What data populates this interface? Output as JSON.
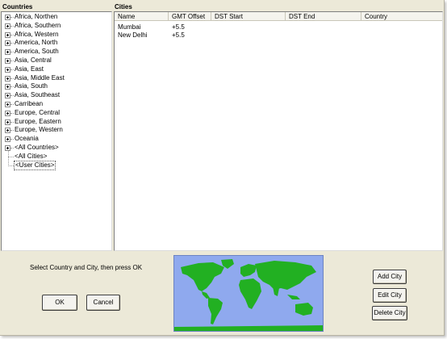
{
  "countries_pane": {
    "title": "Countries",
    "regions": [
      "Africa, Northen",
      "Africa, Southern",
      "Africa, Western",
      "America, North",
      "America, South",
      "Asia, Central",
      "Asia, East",
      "Asia, Middle East",
      "Asia, South",
      "Asia, Southeast",
      "Carribean",
      "Europe, Central",
      "Europe, Eastern",
      "Europe, Western",
      "Oceania",
      "<All Countries>"
    ],
    "all_cities": "<All Cities>",
    "user_cities": "<User Cities>"
  },
  "cities_pane": {
    "title": "Cities",
    "columns": [
      "Name",
      "GMT Offset",
      "DST Start",
      "DST End",
      "Country"
    ],
    "rows": [
      {
        "name": "Mumbai",
        "gmt_offset": "+5.5",
        "dst_start": "",
        "dst_end": "",
        "country": ""
      },
      {
        "name": "New Delhi",
        "gmt_offset": "+5.5",
        "dst_start": "",
        "dst_end": "",
        "country": ""
      }
    ]
  },
  "footer": {
    "instruction": "Select Country and City, then press OK",
    "ok_label": "OK",
    "cancel_label": "Cancel",
    "add_city_label": "Add City",
    "edit_city_label": "Edit City",
    "delete_city_label": "Delete City"
  },
  "colors": {
    "map_ocean": "#8fa9ee",
    "map_land": "#22b022",
    "window_bg": "#ece9d8"
  }
}
